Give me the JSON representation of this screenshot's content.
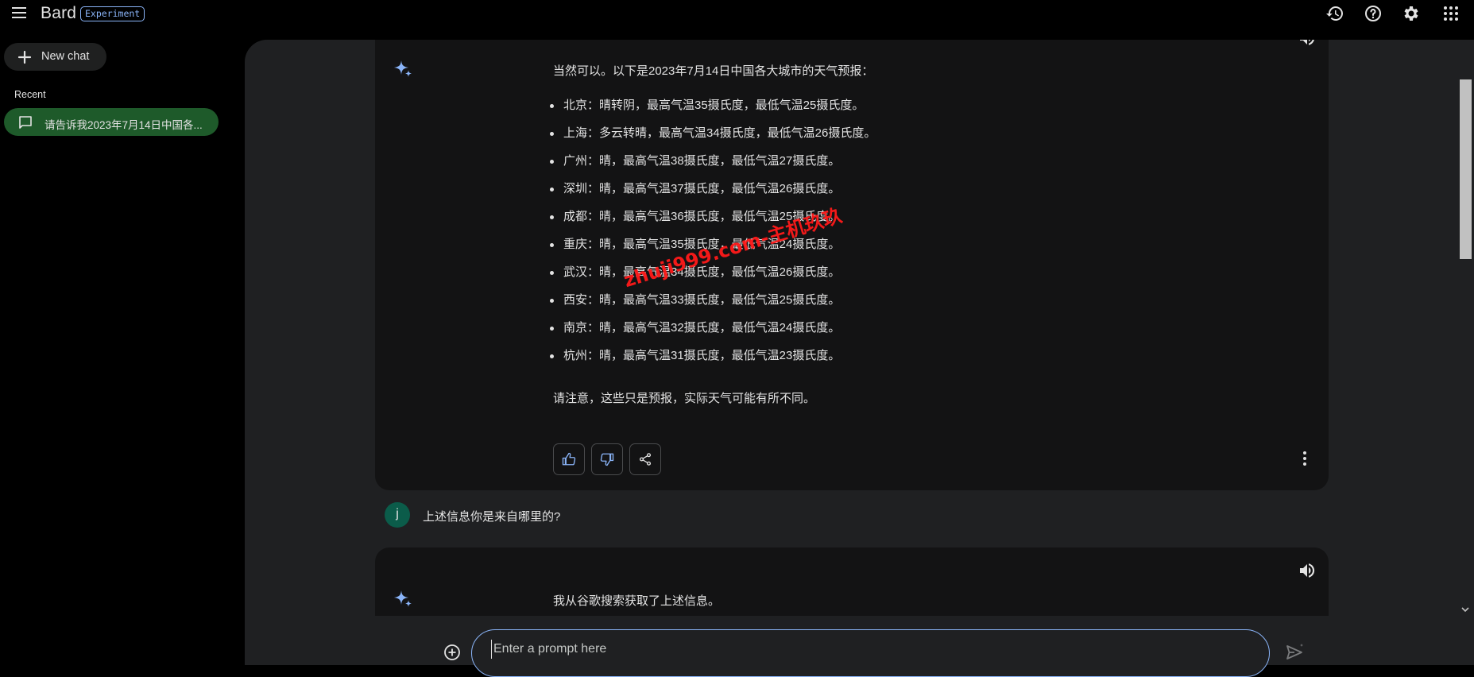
{
  "app": {
    "title": "Bard",
    "badge": "Experiment"
  },
  "topbar": {
    "icons": [
      "history-icon",
      "help-icon",
      "settings-icon",
      "apps-grid-icon"
    ]
  },
  "sidebar": {
    "new_chat_label": "New chat",
    "recent_label": "Recent",
    "recent_items": [
      {
        "label": "请告诉我2023年7月14日中国各..."
      }
    ]
  },
  "conversation": {
    "response1": {
      "intro": "当然可以。以下是2023年7月14日中国各大城市的天气预报：",
      "items": [
        "北京：晴转阴，最高气温35摄氏度，最低气温25摄氏度。",
        "上海：多云转晴，最高气温34摄氏度，最低气温26摄氏度。",
        "广州：晴，最高气温38摄氏度，最低气温27摄氏度。",
        "深圳：晴，最高气温37摄氏度，最低气温26摄氏度。",
        "成都：晴，最高气温36摄氏度，最低气温25摄氏度。",
        "重庆：晴，最高气温35摄氏度，最低气温24摄氏度。",
        "武汉：晴，最高气温34摄氏度，最低气温26摄氏度。",
        "西安：晴，最高气温33摄氏度，最低气温25摄氏度。",
        "南京：晴，最高气温32摄氏度，最低气温24摄氏度。",
        "杭州：晴，最高气温31摄氏度，最低气温23摄氏度。"
      ],
      "note": "请注意，这些只是预报，实际天气可能有所不同。"
    },
    "user_message": {
      "avatar_letter": "j",
      "text": "上述信息你是来自哪里的?"
    },
    "response2": {
      "text": "我从谷歌搜索获取了上述信息。"
    }
  },
  "prompt": {
    "placeholder": "Enter a prompt here",
    "value": ""
  },
  "watermark": "zhuji999.com-主机玖玖",
  "colors": {
    "accent": "#8ab4f8",
    "recent_active": "#1e5a2a",
    "avatar": "#0b5c4a",
    "watermark": "#ff1a1a"
  }
}
